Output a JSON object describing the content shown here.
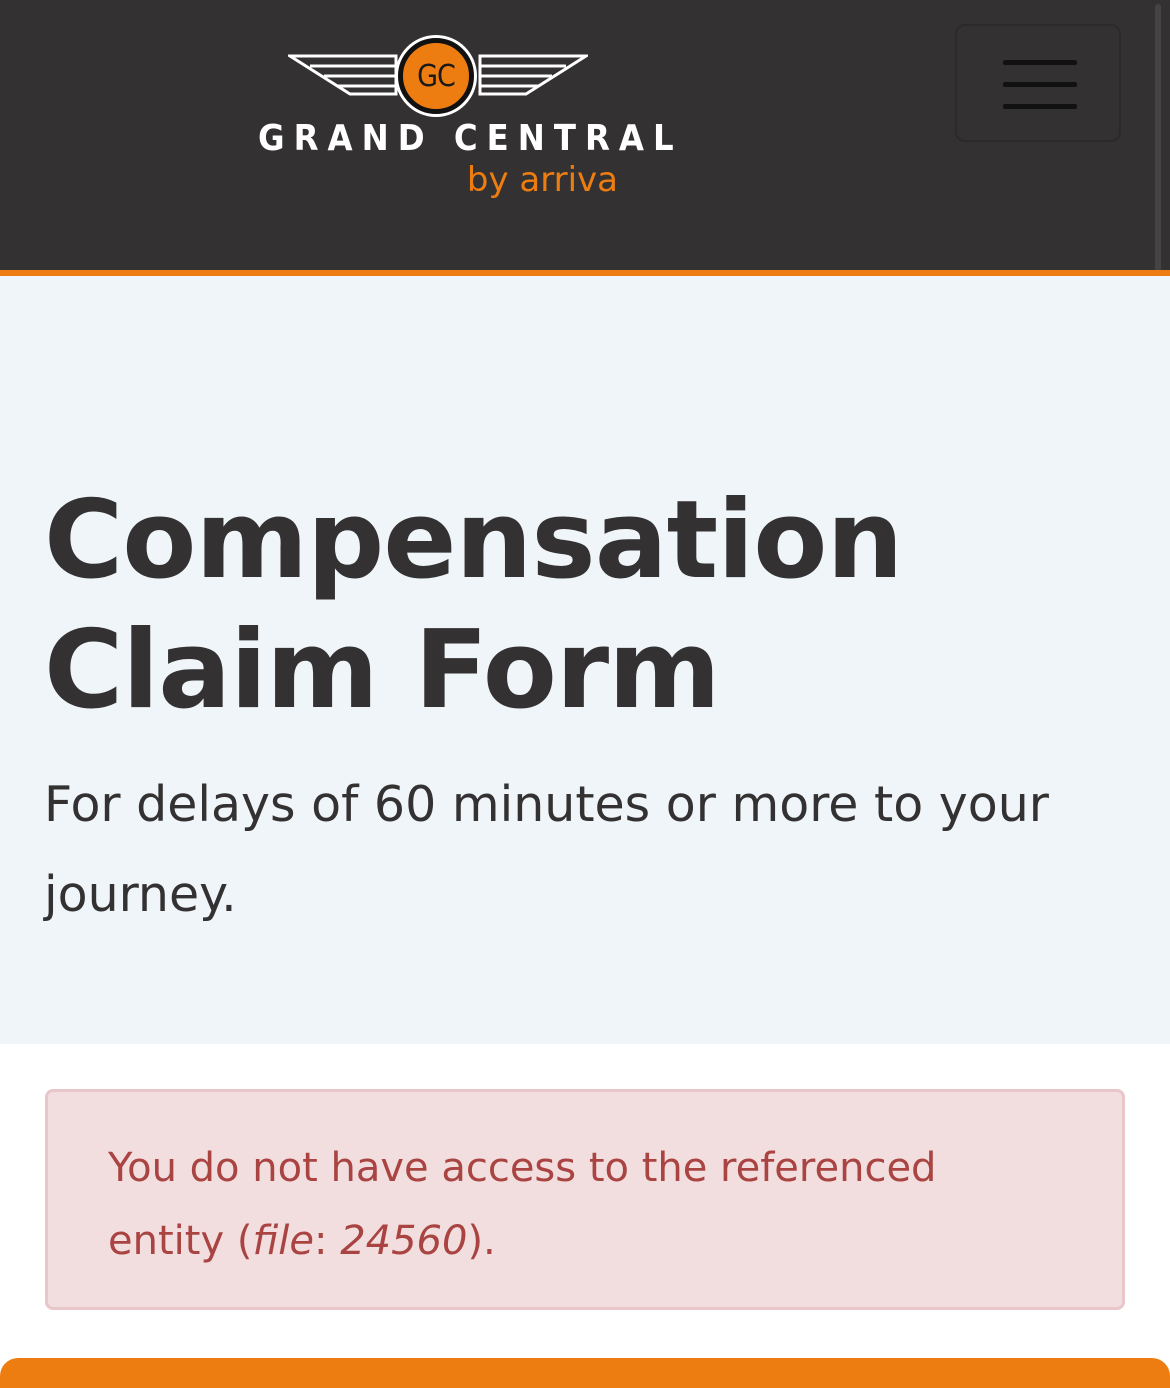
{
  "header": {
    "logo": {
      "badge": "GC",
      "name": "GRAND CENTRAL",
      "tagline": "by arriva"
    },
    "menu_icon": "hamburger-icon"
  },
  "hero": {
    "title": "Compensation Claim Form",
    "subtitle": "For delays of 60 minutes or more to your journey."
  },
  "alert": {
    "message_prefix": "You do not have access to the referenced entity (",
    "entity_type": "file",
    "separator": ": ",
    "entity_id": "24560",
    "message_suffix": ")."
  },
  "colors": {
    "header_bg": "#333132",
    "accent": "#ee7d11",
    "hero_bg": "#eff5f8",
    "alert_bg": "#f2dede",
    "alert_text": "#a94442"
  }
}
